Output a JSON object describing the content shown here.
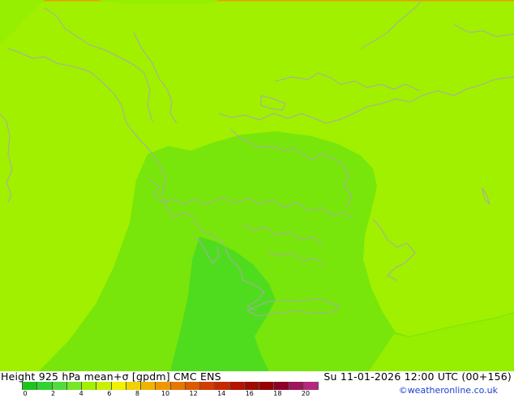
{
  "footer": {
    "title_left": "Height 925 hPa mean+σ [gpdm] CMC ENS",
    "title_right": "Su 11-01-2026 12:00 UTC (00+156)",
    "credit": "©weatheronline.co.uk"
  },
  "legend": {
    "colors": [
      "#1ec31e",
      "#32d232",
      "#50dc3c",
      "#78e628",
      "#a0f000",
      "#c8f000",
      "#f0f000",
      "#f0d200",
      "#f0b400",
      "#f09600",
      "#e67800",
      "#dc5a00",
      "#d23c00",
      "#c82800",
      "#b41400",
      "#a00a00",
      "#960000",
      "#8c0028",
      "#a0145a",
      "#b4287d"
    ],
    "tick_labels": [
      "0",
      "2",
      "4",
      "6",
      "8",
      "10",
      "12",
      "14",
      "16",
      "18",
      "20"
    ]
  },
  "map": {
    "field_colors": {
      "lightest": "#a0f000",
      "light": "#96ee00",
      "medium": "#78e60a",
      "dark": "#50dc1e"
    },
    "border_color": "#a9a9a9",
    "top_edge_color": "#e6a000"
  }
}
